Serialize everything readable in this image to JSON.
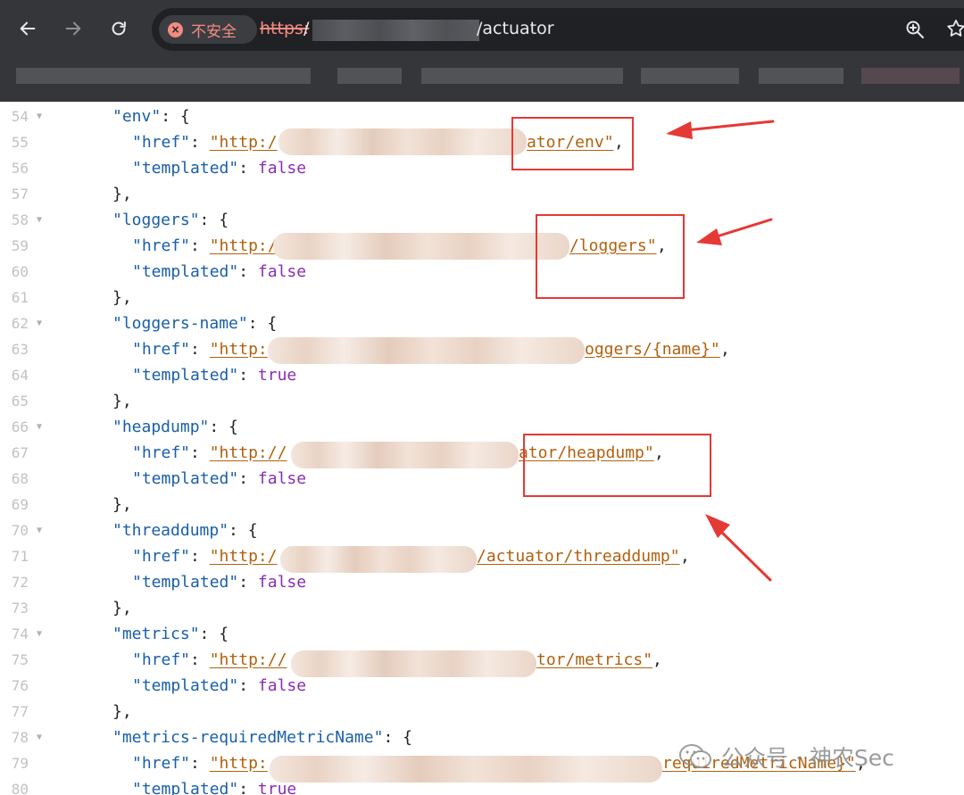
{
  "browser": {
    "security_label": "不安全",
    "url_scheme": "https:",
    "url_separator": "/",
    "url_path": "/actuator"
  },
  "colors": {
    "key": "#1a5fa8",
    "url": "#b2600d",
    "boolean": "#8a2db3",
    "annotation": "#e53935",
    "chrome": "#35363a"
  },
  "code_lines": [
    {
      "n": "54",
      "fold": true,
      "key": "\"env\"",
      "after": ": {"
    },
    {
      "n": "55",
      "fold": false,
      "key": "\"href\"",
      "url_start": "\"http:/",
      "url_end": "ator/env\"",
      "after": ","
    },
    {
      "n": "56",
      "fold": false,
      "key": "\"templated\"",
      "value": "false"
    },
    {
      "n": "57",
      "fold": false,
      "text": "},"
    },
    {
      "n": "58",
      "fold": true,
      "key": "\"loggers\"",
      "after": ": {"
    },
    {
      "n": "59",
      "fold": false,
      "key": "\"href\"",
      "url_start": "\"http:/",
      "url_end": "/loggers\"",
      "after": ","
    },
    {
      "n": "60",
      "fold": false,
      "key": "\"templated\"",
      "value": "false"
    },
    {
      "n": "61",
      "fold": false,
      "text": "},"
    },
    {
      "n": "62",
      "fold": true,
      "key": "\"loggers-name\"",
      "after": ": {"
    },
    {
      "n": "63",
      "fold": false,
      "key": "\"href\"",
      "url_start": "\"http:",
      "url_end": "oggers/{name}\"",
      "after": ","
    },
    {
      "n": "64",
      "fold": false,
      "key": "\"templated\"",
      "value": "true"
    },
    {
      "n": "65",
      "fold": false,
      "text": "},"
    },
    {
      "n": "66",
      "fold": true,
      "key": "\"heapdump\"",
      "after": ": {"
    },
    {
      "n": "67",
      "fold": false,
      "key": "\"href\"",
      "url_start": "\"http://",
      "url_end": "ator/heapdump\"",
      "after": ","
    },
    {
      "n": "68",
      "fold": false,
      "key": "\"templated\"",
      "value": "false"
    },
    {
      "n": "69",
      "fold": false,
      "text": "},"
    },
    {
      "n": "70",
      "fold": true,
      "key": "\"threaddump\"",
      "after": ": {"
    },
    {
      "n": "71",
      "fold": false,
      "key": "\"href\"",
      "url_start": "\"http:/",
      "url_end": "/actuator/threaddump\"",
      "after": ","
    },
    {
      "n": "72",
      "fold": false,
      "key": "\"templated\"",
      "value": "false"
    },
    {
      "n": "73",
      "fold": false,
      "text": "},"
    },
    {
      "n": "74",
      "fold": true,
      "key": "\"metrics\"",
      "after": ": {"
    },
    {
      "n": "75",
      "fold": false,
      "key": "\"href\"",
      "url_start": "\"http://",
      "url_end": "tor/metrics\"",
      "after": ","
    },
    {
      "n": "76",
      "fold": false,
      "key": "\"templated\"",
      "value": "false"
    },
    {
      "n": "77",
      "fold": false,
      "text": "},"
    },
    {
      "n": "78",
      "fold": true,
      "key": "\"metrics-requiredMetricName\"",
      "after": ": {"
    },
    {
      "n": "79",
      "fold": false,
      "key": "\"href\"",
      "url_start": "\"http:",
      "url_end": "requiredMetricName}\"",
      "after": ","
    },
    {
      "n": "80",
      "fold": false,
      "key": "\"templated\"",
      "value": "true"
    }
  ],
  "watermark": {
    "text": "公众号 · 神农Sec"
  }
}
